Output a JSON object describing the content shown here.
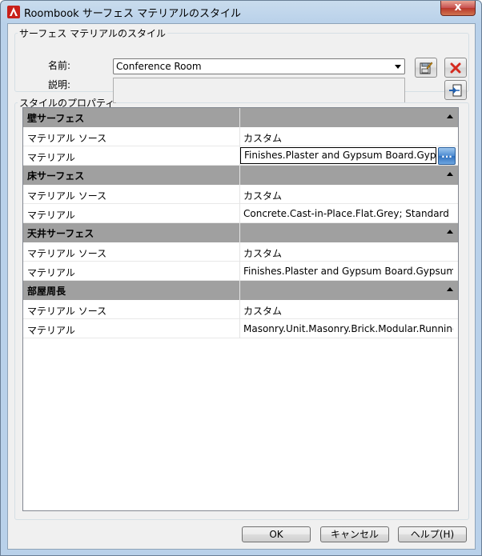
{
  "window": {
    "title": "Roombook サーフェス マテリアルのスタイル",
    "close_label": "x"
  },
  "style_group": {
    "legend": "サーフェス マテリアルのスタイル",
    "name_label": "名前:",
    "name_value": "Conference Room",
    "description_label": "説明:",
    "description_value": ""
  },
  "properties": {
    "legend": "スタイルのプロパティ",
    "categories": [
      {
        "name": "壁サーフェス",
        "rows": [
          {
            "key": "マテリアル ソース",
            "value": "カスタム"
          },
          {
            "key": "マテリアル",
            "value": "Finishes.Plaster and Gypsum Board.Gypsum"
          }
        ]
      },
      {
        "name": "床サーフェス",
        "rows": [
          {
            "key": "マテリアル ソース",
            "value": "カスタム"
          },
          {
            "key": "マテリアル",
            "value": "Concrete.Cast-in-Place.Flat.Grey; Standard"
          }
        ]
      },
      {
        "name": "天井サーフェス",
        "rows": [
          {
            "key": "マテリアル ソース",
            "value": "カスタム"
          },
          {
            "key": "マテリアル",
            "value": "Finishes.Plaster and Gypsum Board.Gypsum"
          }
        ]
      },
      {
        "name": "部屋周長",
        "rows": [
          {
            "key": "マテリアル ソース",
            "value": "カスタム"
          },
          {
            "key": "マテリアル",
            "value": "Masonry.Unit.Masonry.Brick.Modular.Running"
          }
        ]
      }
    ],
    "ellipsis_label": "..."
  },
  "buttons": {
    "ok": "OK",
    "cancel": "キャンセル",
    "help": "ヘルプ(H)"
  },
  "colors": {
    "category_header": "#a0a0a0",
    "ellipsis_button": "#4b8ad1",
    "delete_icon": "#d42a1e"
  }
}
